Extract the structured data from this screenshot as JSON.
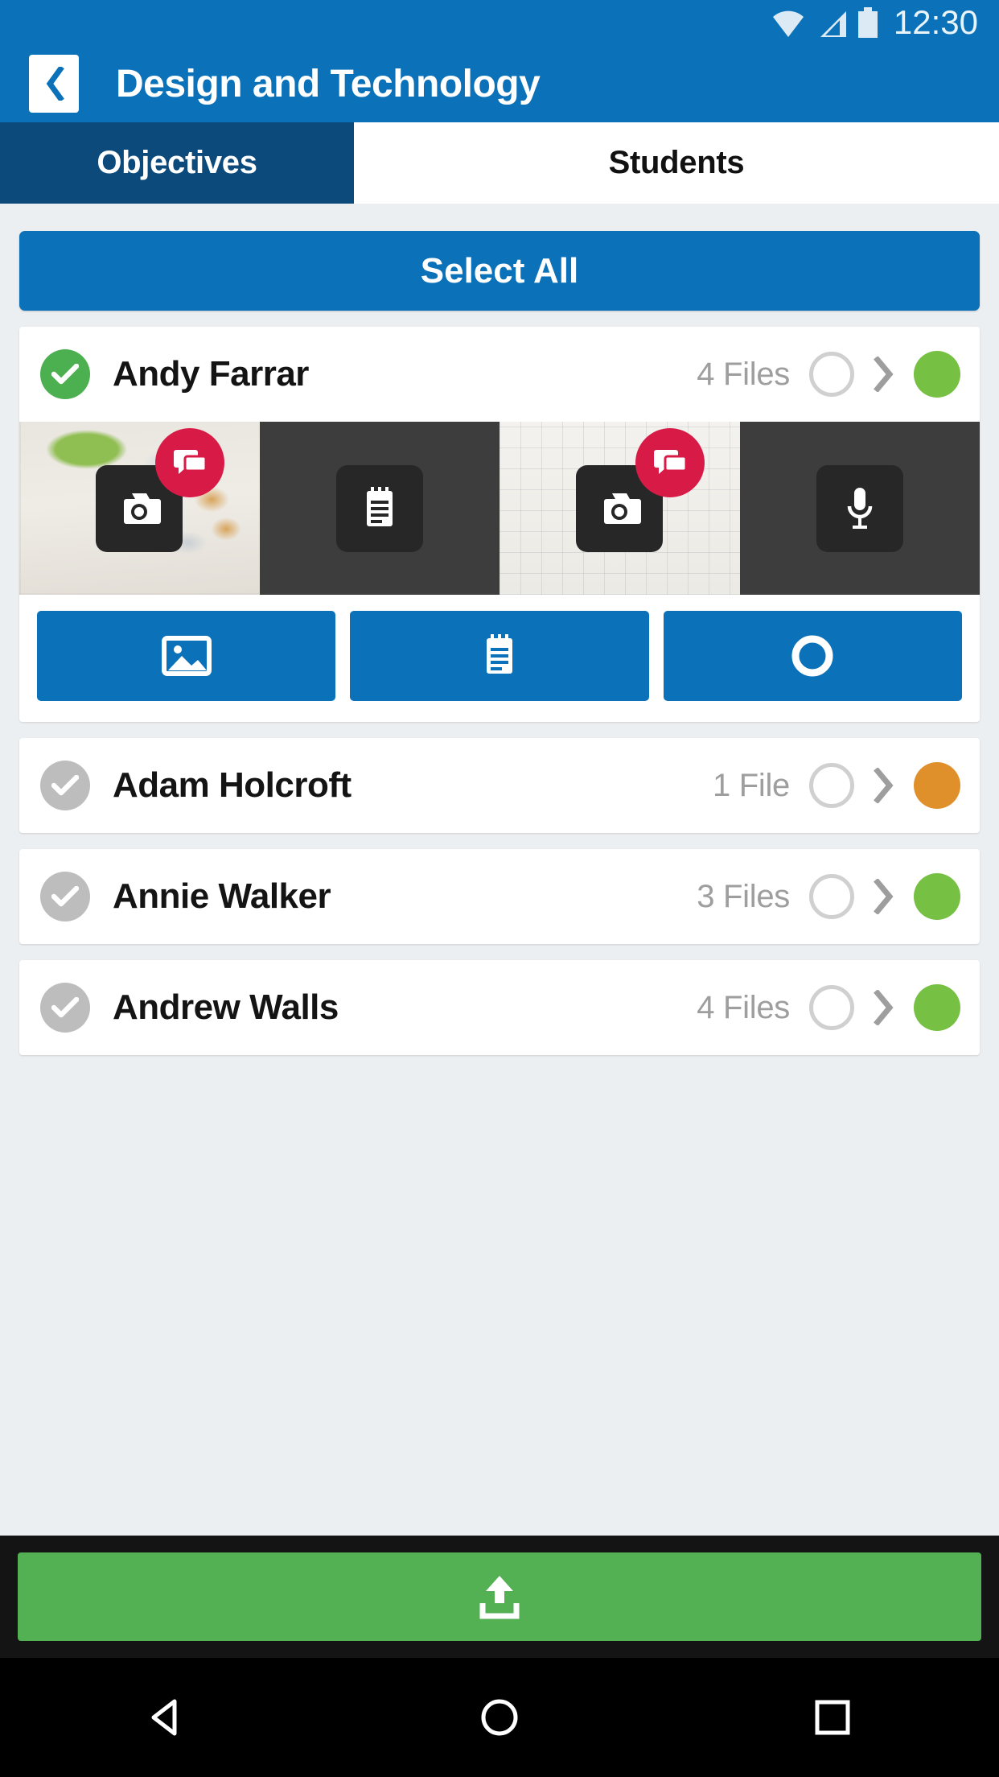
{
  "status_bar": {
    "time": "12:30",
    "icons": [
      "wifi-icon",
      "signal-icon",
      "battery-icon"
    ]
  },
  "header": {
    "back_icon": "chevron-left-icon",
    "title": "Design and Technology",
    "background_color": "#0b72b9"
  },
  "tabs": [
    {
      "label": "Objectives",
      "active": true,
      "background_color": "#0d4a7c",
      "text_color": "#ffffff"
    },
    {
      "label": "Students",
      "active": false,
      "background_color": "#ffffff",
      "text_color": "#111111"
    }
  ],
  "select_all": {
    "label": "Select All",
    "background_color": "#0b72b9"
  },
  "students": [
    {
      "name": "Andy Farrar",
      "files_label": "4 Files",
      "selected": true,
      "check_color": "#4cb050",
      "status_color": "#76c043",
      "chevron": "chevron-right-icon",
      "expanded": true
    },
    {
      "name": "Adam Holcroft",
      "files_label": "1 File",
      "selected": false,
      "check_color": "#bdbdbd",
      "status_color": "#e0902a",
      "chevron": "chevron-right-icon",
      "expanded": false
    },
    {
      "name": "Annie Walker",
      "files_label": "3 Files",
      "selected": false,
      "check_color": "#bdbdbd",
      "status_color": "#76c043",
      "chevron": "chevron-right-icon",
      "expanded": false
    },
    {
      "name": "Andrew Walls",
      "files_label": "4 Files",
      "selected": false,
      "check_color": "#bdbdbd",
      "status_color": "#76c043",
      "chevron": "chevron-right-icon",
      "expanded": false
    }
  ],
  "media_strip": [
    {
      "icon": "camera-icon",
      "kind": "photo",
      "has_comment_badge": true,
      "badge_icon": "comment-icon",
      "background": "photo-thumbnail"
    },
    {
      "icon": "notepad-icon",
      "kind": "note",
      "has_comment_badge": false,
      "badge_icon": "",
      "background": "dark"
    },
    {
      "icon": "camera-icon",
      "kind": "photo",
      "has_comment_badge": true,
      "badge_icon": "comment-icon",
      "background": "photo-thumbnail"
    },
    {
      "icon": "microphone-icon",
      "kind": "audio",
      "has_comment_badge": false,
      "badge_icon": "",
      "background": "dark"
    }
  ],
  "action_buttons": [
    {
      "icon": "image-icon",
      "background_color": "#0b72b9"
    },
    {
      "icon": "notepad-icon",
      "background_color": "#0b72b9"
    },
    {
      "icon": "record-icon",
      "background_color": "#0b72b9"
    }
  ],
  "upload_bar": {
    "icon": "upload-icon",
    "button_color": "#53b154",
    "background_color": "#141414"
  },
  "android_nav": [
    {
      "icon": "back-triangle-icon"
    },
    {
      "icon": "home-circle-icon"
    },
    {
      "icon": "recents-square-icon"
    }
  ]
}
